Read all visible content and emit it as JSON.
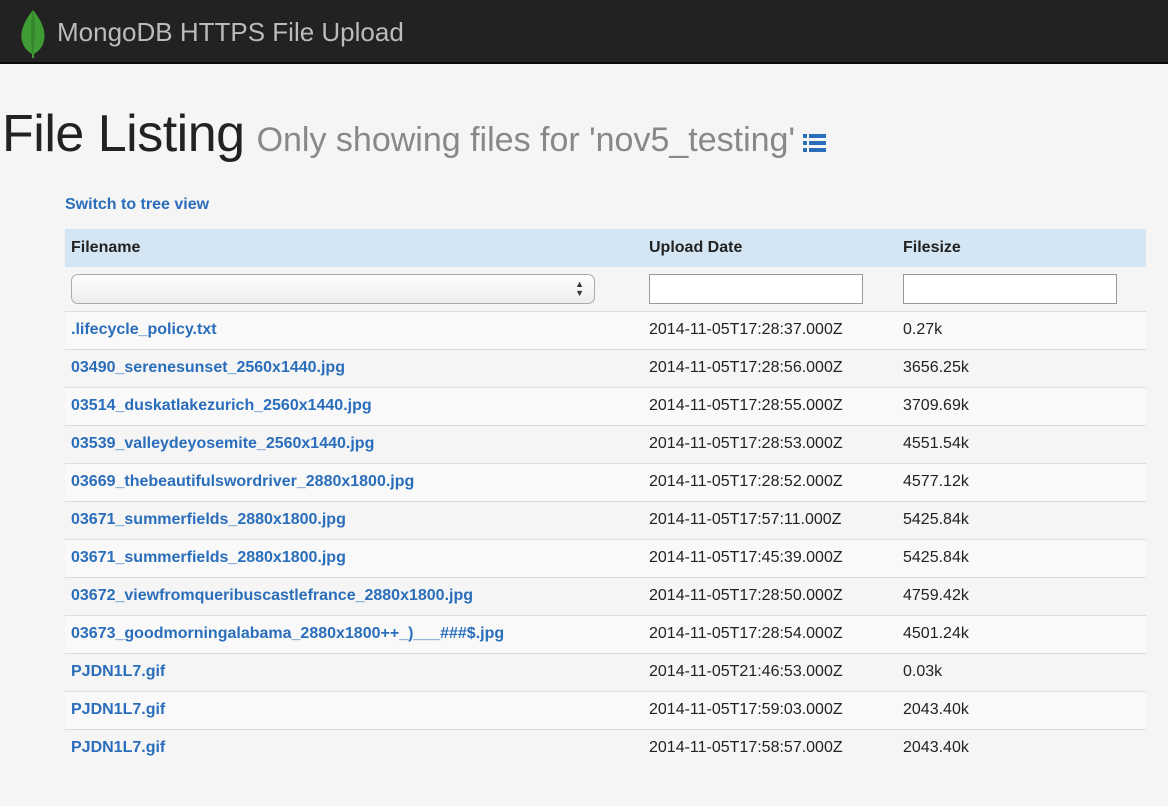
{
  "navbar": {
    "brand": "MongoDB HTTPS File Upload"
  },
  "heading": {
    "title": "File Listing",
    "subtitle": "Only showing files for 'nov5_testing'"
  },
  "switch_link": "Switch to tree view",
  "table": {
    "columns": [
      "Filename",
      "Upload Date",
      "Filesize"
    ],
    "filters": {
      "filename_selected": "",
      "date_value": "",
      "size_value": ""
    },
    "rows": [
      {
        "filename": ".lifecycle_policy.txt",
        "date": "2014-11-05T17:28:37.000Z",
        "size": "0.27k"
      },
      {
        "filename": "03490_serenesunset_2560x1440.jpg",
        "date": "2014-11-05T17:28:56.000Z",
        "size": "3656.25k"
      },
      {
        "filename": "03514_duskatlakezurich_2560x1440.jpg",
        "date": "2014-11-05T17:28:55.000Z",
        "size": "3709.69k"
      },
      {
        "filename": "03539_valleydeyosemite_2560x1440.jpg",
        "date": "2014-11-05T17:28:53.000Z",
        "size": "4551.54k"
      },
      {
        "filename": "03669_thebeautifulswordriver_2880x1800.jpg",
        "date": "2014-11-05T17:28:52.000Z",
        "size": "4577.12k"
      },
      {
        "filename": "03671_summerfields_2880x1800.jpg",
        "date": "2014-11-05T17:57:11.000Z",
        "size": "5425.84k"
      },
      {
        "filename": "03671_summerfields_2880x1800.jpg",
        "date": "2014-11-05T17:45:39.000Z",
        "size": "5425.84k"
      },
      {
        "filename": "03672_viewfromqueribuscastlefrance_2880x1800.jpg",
        "date": "2014-11-05T17:28:50.000Z",
        "size": "4759.42k"
      },
      {
        "filename": "03673_goodmorningalabama_2880x1800++_)___###$.jpg",
        "date": "2014-11-05T17:28:54.000Z",
        "size": "4501.24k"
      },
      {
        "filename": "PJDN1L7.gif",
        "date": "2014-11-05T21:46:53.000Z",
        "size": "0.03k"
      },
      {
        "filename": "PJDN1L7.gif",
        "date": "2014-11-05T17:59:03.000Z",
        "size": "2043.40k"
      },
      {
        "filename": "PJDN1L7.gif",
        "date": "2014-11-05T17:58:57.000Z",
        "size": "2043.40k"
      }
    ]
  },
  "icons": {
    "logo": "mongodb-leaf-icon",
    "list": "list-icon"
  },
  "colors": {
    "navbar_bg": "#222222",
    "link": "#2a6ebb",
    "header_row_bg": "#d4e6f4",
    "leaf_green": "#3f9c35"
  }
}
